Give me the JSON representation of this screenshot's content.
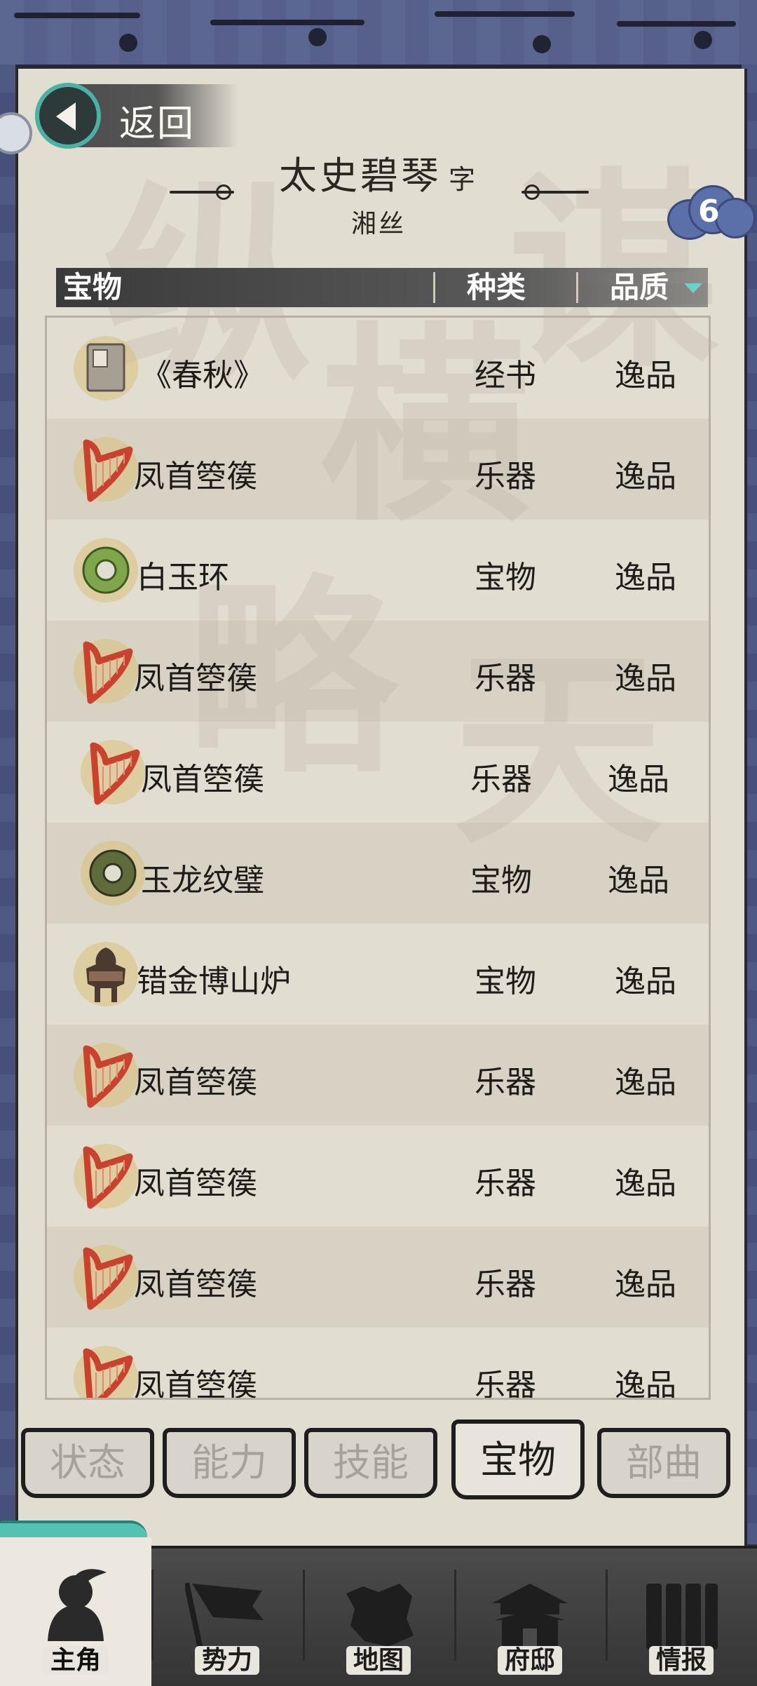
{
  "header": {
    "back_label": "返回",
    "character_name": "太史碧琴",
    "courtesy_label": "字",
    "courtesy_name": "湘丝",
    "badge_count": "6"
  },
  "table": {
    "columns": [
      "宝物",
      "种类",
      "品质"
    ],
    "sort_column": "品质",
    "rows": [
      {
        "icon": "book-icon",
        "name": "《春秋》",
        "type": "经书",
        "quality": "逸品"
      },
      {
        "icon": "harp-icon",
        "name": "凤首箜篌",
        "type": "乐器",
        "quality": "逸品"
      },
      {
        "icon": "jade-ring-icon",
        "name": "白玉环",
        "type": "宝物",
        "quality": "逸品"
      },
      {
        "icon": "harp-icon",
        "name": "凤首箜篌",
        "type": "乐器",
        "quality": "逸品"
      },
      {
        "icon": "harp-icon",
        "name": "凤首箜篌",
        "type": "乐器",
        "quality": "逸品"
      },
      {
        "icon": "jade-disc-icon",
        "name": "玉龙纹璧",
        "type": "宝物",
        "quality": "逸品"
      },
      {
        "icon": "censer-icon",
        "name": "错金博山炉",
        "type": "宝物",
        "quality": "逸品"
      },
      {
        "icon": "harp-icon",
        "name": "凤首箜篌",
        "type": "乐器",
        "quality": "逸品"
      },
      {
        "icon": "harp-icon",
        "name": "凤首箜篌",
        "type": "乐器",
        "quality": "逸品"
      },
      {
        "icon": "harp-icon",
        "name": "凤首箜篌",
        "type": "乐器",
        "quality": "逸品"
      },
      {
        "icon": "harp-icon",
        "name": "凤首箜篌",
        "type": "乐器",
        "quality": "逸品"
      }
    ]
  },
  "tabs": [
    {
      "label": "状态",
      "active": false
    },
    {
      "label": "能力",
      "active": false
    },
    {
      "label": "技能",
      "active": false
    },
    {
      "label": "宝物",
      "active": true
    },
    {
      "label": "部曲",
      "active": false
    }
  ],
  "bottom_nav": [
    {
      "label": "主角",
      "icon": "hero-icon",
      "active": true
    },
    {
      "label": "势力",
      "icon": "banner-icon",
      "active": false
    },
    {
      "label": "地图",
      "icon": "map-icon",
      "active": false
    },
    {
      "label": "府邸",
      "icon": "mansion-icon",
      "active": false
    },
    {
      "label": "情报",
      "icon": "scroll-icon",
      "active": false
    }
  ],
  "colors": {
    "paper": "#e2ddd1",
    "frame": "#56608a",
    "accent_teal": "#4ab1a5",
    "badge_blue": "#5b6fa8",
    "harp_red": "#c9422e",
    "jade_green": "#6d9a3a"
  }
}
